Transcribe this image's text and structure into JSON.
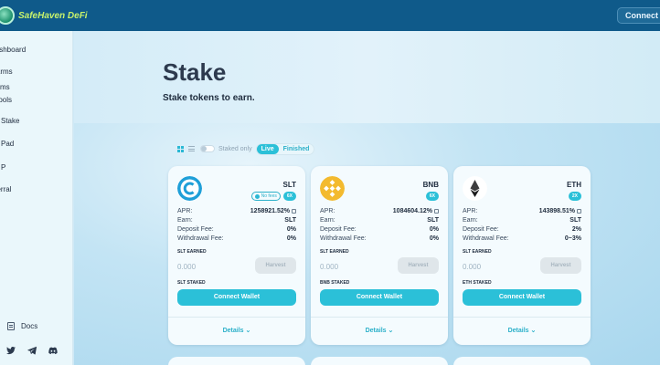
{
  "brand": {
    "name": "SafeHaven DeFi"
  },
  "header": {
    "connect_label": "Connect Wallet"
  },
  "sidebar": {
    "items": [
      {
        "label": "Dashboard"
      },
      {
        "label": "Farms"
      },
      {
        "label": "Farms"
      },
      {
        "label": "Pools"
      },
      {
        "label": "Stake"
      },
      {
        "label": "Pad"
      },
      {
        "label": "P"
      },
      {
        "label": "Referral"
      }
    ],
    "docs_label": "Docs",
    "socials": [
      "twitter-icon",
      "telegram-icon",
      "discord-icon"
    ]
  },
  "hero": {
    "title": "Stake",
    "subtitle": "Stake tokens to earn."
  },
  "controls": {
    "staked_only_label": "Staked only",
    "tabs": [
      {
        "label": "Live",
        "active": true
      },
      {
        "label": "Finished",
        "active": false
      }
    ]
  },
  "labels": {
    "apr": "APR:",
    "earn": "Earn:",
    "deposit_fee": "Deposit Fee:",
    "withdrawal_fee": "Withdrawal Fee:",
    "harvest": "Harvest",
    "connect": "Connect Wallet",
    "details": "Details"
  },
  "pools": [
    {
      "name": "SLT",
      "no_fees": "No fees",
      "multiplier": "6X",
      "apr": "1258921.52%",
      "earn": "SLT",
      "deposit_fee": "0%",
      "withdrawal_fee": "0%",
      "earned_label": "SLT EARNED",
      "earned_value": "0.000",
      "staked_label": "SLT STAKED",
      "icon": "saferhaven-token-icon"
    },
    {
      "name": "BNB",
      "multiplier": "6X",
      "apr": "1084604.12%",
      "earn": "SLT",
      "deposit_fee": "0%",
      "withdrawal_fee": "0%",
      "earned_label": "SLT EARNED",
      "earned_value": "0.000",
      "staked_label": "BNB STAKED",
      "icon": "bnb-token-icon"
    },
    {
      "name": "ETH",
      "multiplier": "2X",
      "apr": "143898.51%",
      "earn": "SLT",
      "deposit_fee": "2%",
      "withdrawal_fee": "0~3%",
      "earned_label": "SLT EARNED",
      "earned_value": "0.000",
      "staked_label": "ETH STAKED",
      "icon": "eth-token-icon"
    }
  ],
  "colors": {
    "accent": "#2bc0d8",
    "topbar": "#0f5a8a",
    "brand_text": "#c8f26b"
  }
}
